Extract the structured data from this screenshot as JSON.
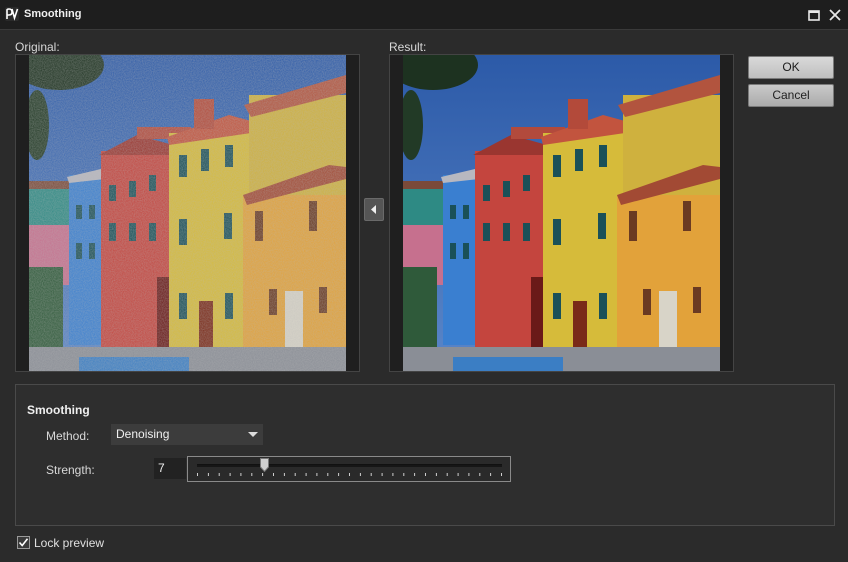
{
  "window": {
    "title": "Smoothing"
  },
  "labels": {
    "original": "Original:",
    "result": "Result:"
  },
  "buttons": {
    "ok": "OK",
    "cancel": "Cancel"
  },
  "panel": {
    "title": "Smoothing",
    "method_label": "Method:",
    "method_value": "Denoising",
    "strength_label": "Strength:",
    "strength_value": "7",
    "strength_fraction": 0.22
  },
  "lock_preview": {
    "label": "Lock preview",
    "checked": true
  },
  "icons": [
    "app-icon",
    "maximize-icon",
    "close-icon",
    "copy-left-arrow-icon",
    "dropdown-chevron-icon",
    "checkmark-icon"
  ]
}
